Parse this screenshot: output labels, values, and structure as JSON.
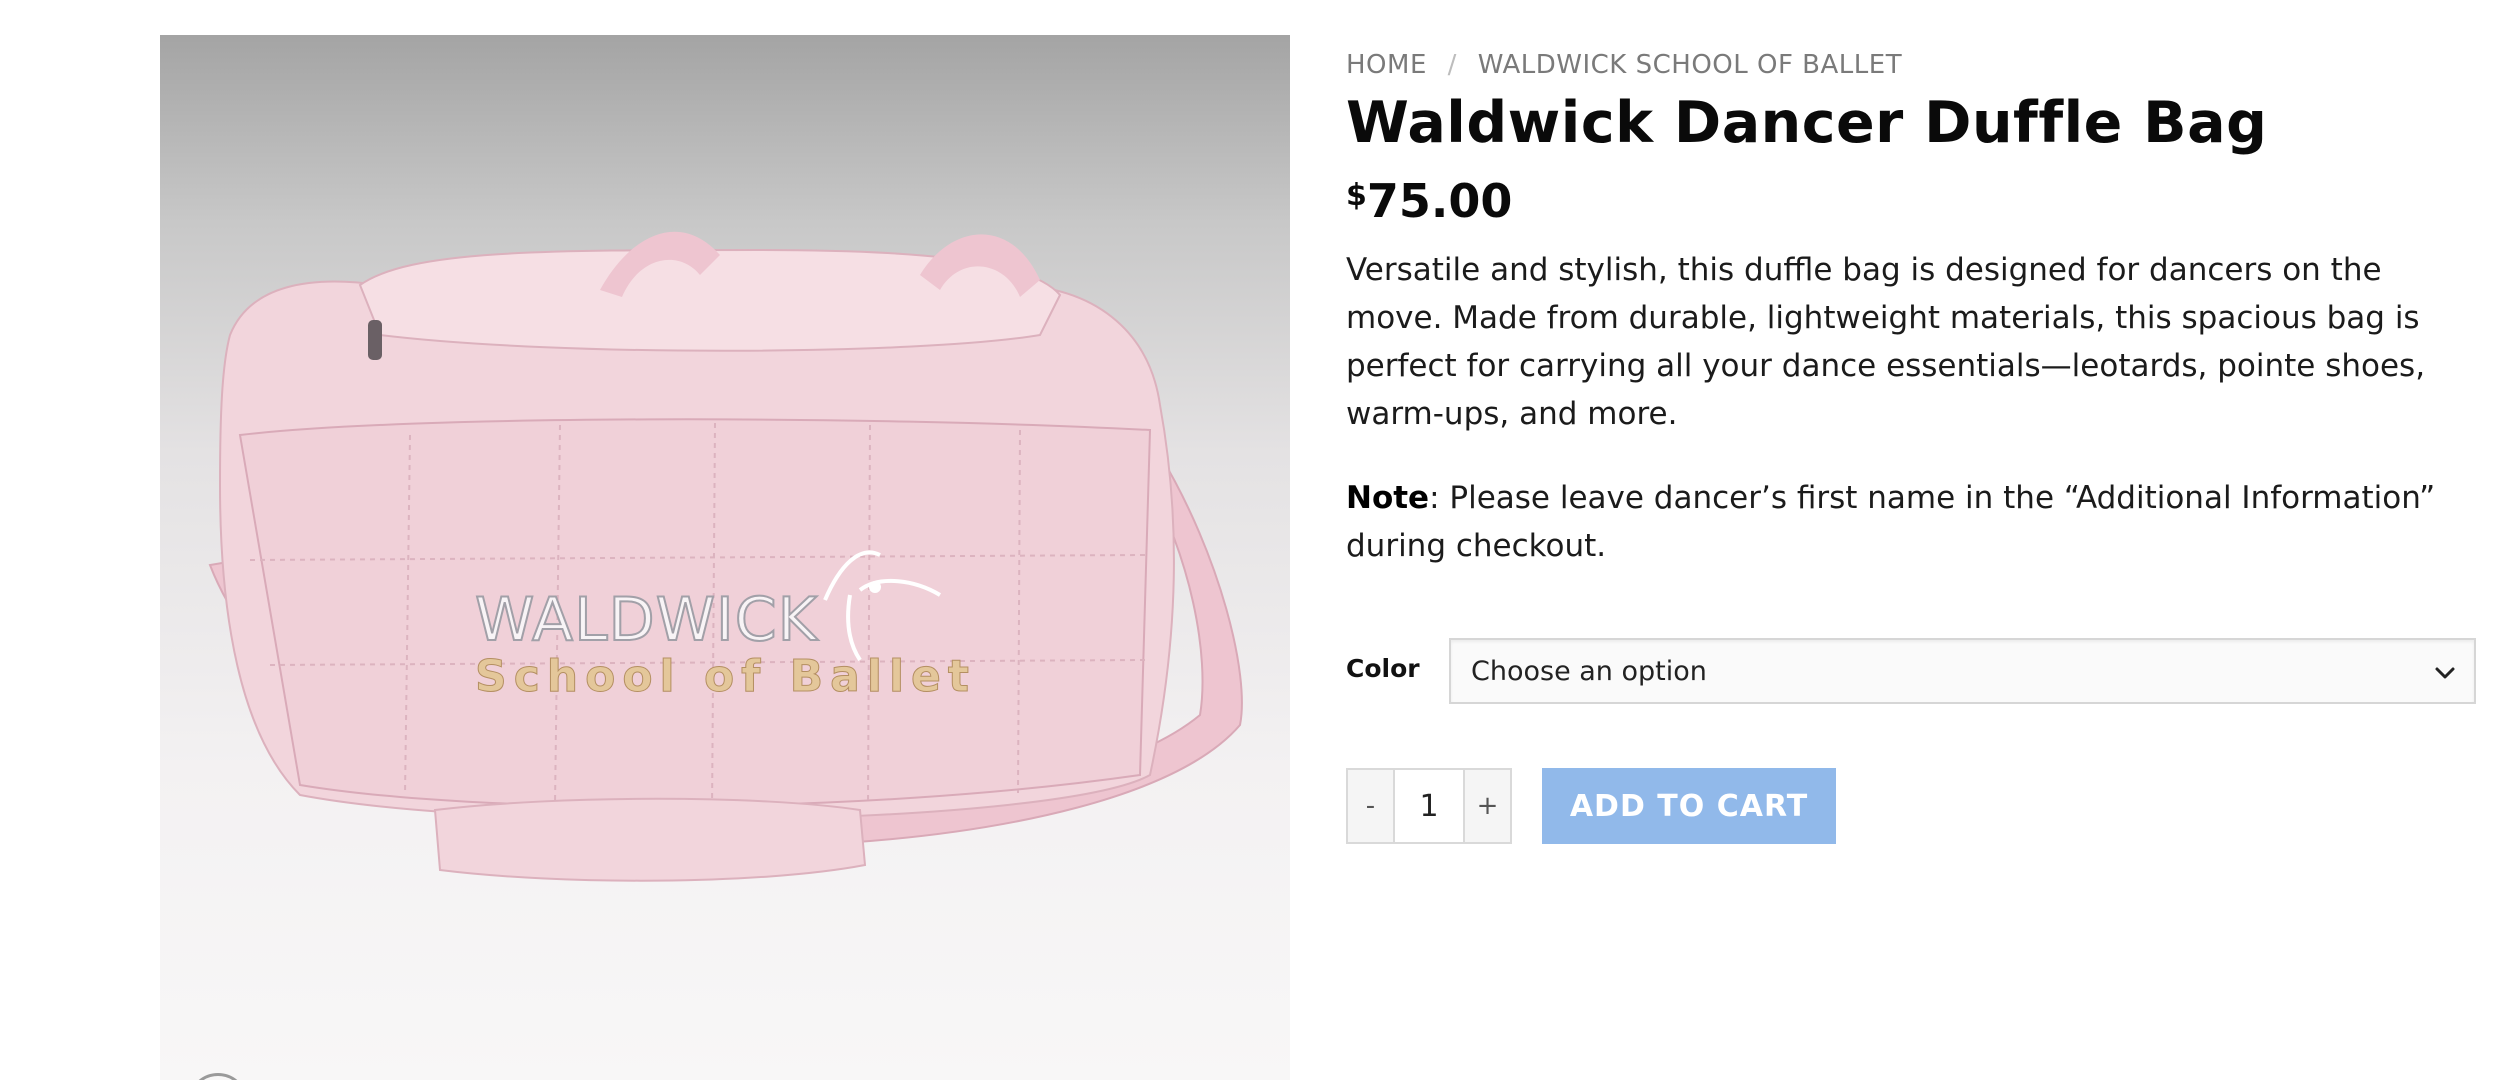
{
  "breadcrumb": {
    "home": "HOME",
    "separator": "/",
    "category": "WALDWICK SCHOOL OF BALLET"
  },
  "product": {
    "title": "Waldwick Dancer Duffle Bag",
    "currency_symbol": "$",
    "price": "75.00",
    "description": "Versatile and stylish, this duffle bag is designed for dancers on the move. Made from durable, lightweight materials, this spacious bag is perfect for carrying all your dance essentials—leotards, pointe shoes, warm-ups, and more.",
    "note_label": "Note",
    "note_text": ": Please leave dancer’s first name in the “Additional Information” during checkout."
  },
  "image": {
    "logo_line1": "WALDWICK",
    "logo_line2": "School of Ballet",
    "bag_color": "#f0d4db"
  },
  "variation": {
    "label": "Color",
    "selected": "Choose an option",
    "icon": "chevron-down-icon"
  },
  "quantity": {
    "minus": "-",
    "value": "1",
    "plus": "+"
  },
  "cart": {
    "add_label": "ADD TO CART",
    "button_color": "#91b9ea"
  }
}
